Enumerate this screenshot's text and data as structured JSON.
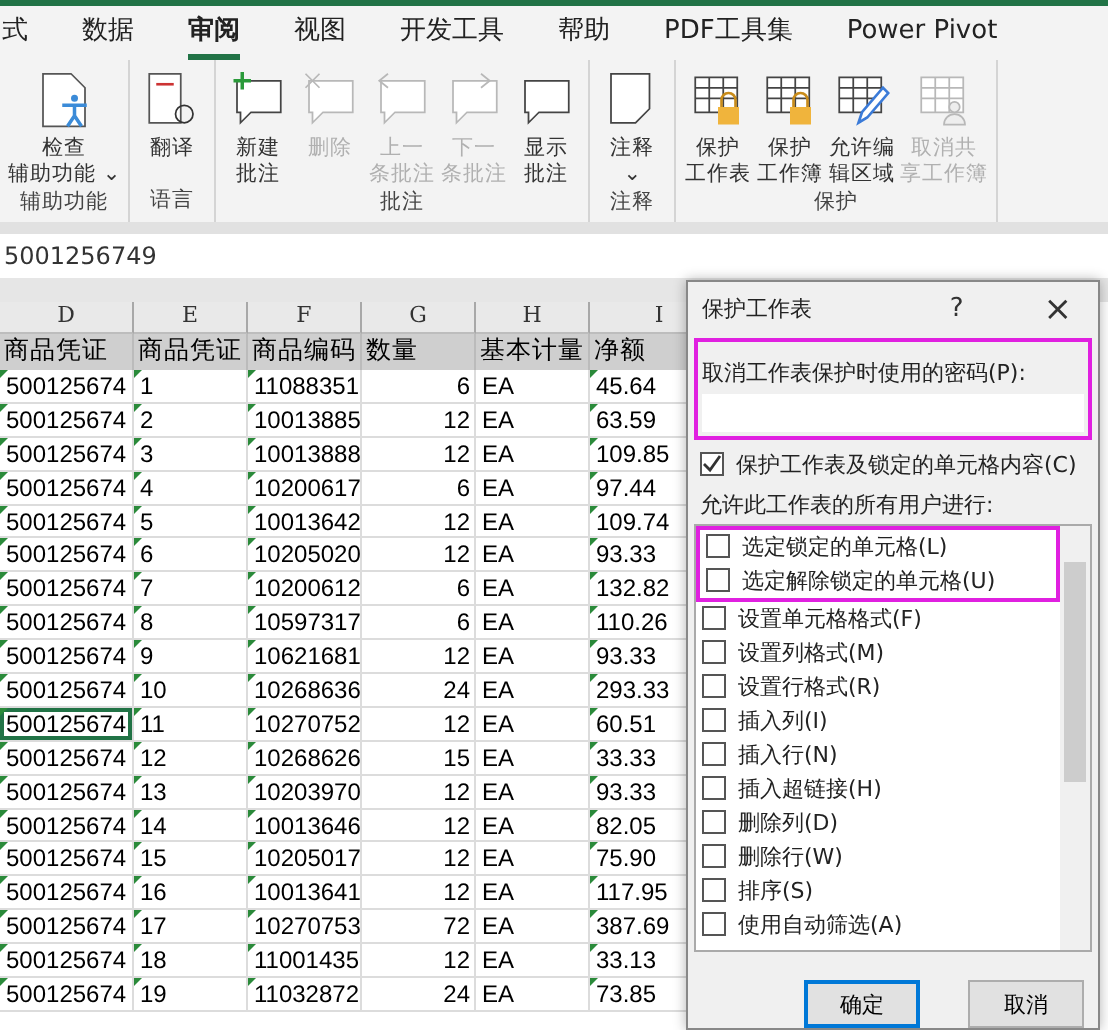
{
  "ribbon_tabs": [
    {
      "label": "式",
      "selected": false
    },
    {
      "label": "数据",
      "selected": false
    },
    {
      "label": "审阅",
      "selected": true
    },
    {
      "label": "视图",
      "selected": false
    },
    {
      "label": "开发工具",
      "selected": false
    },
    {
      "label": "帮助",
      "selected": false
    },
    {
      "label": "PDF工具集",
      "selected": false
    },
    {
      "label": "Power Pivot",
      "selected": false
    }
  ],
  "ribbon_groups": [
    {
      "label": "辅助功能",
      "buttons": [
        {
          "kind": "accessibility",
          "lines": [
            "检查",
            "辅助功能 ⌄"
          ],
          "disabled": false
        }
      ]
    },
    {
      "label": "语言",
      "buttons": [
        {
          "kind": "translate",
          "lines": [
            "翻译"
          ],
          "disabled": false
        }
      ]
    },
    {
      "label": "批注",
      "buttons": [
        {
          "kind": "new-comment",
          "lines": [
            "新建",
            "批注"
          ],
          "disabled": false
        },
        {
          "kind": "delete-comment",
          "lines": [
            "删除"
          ],
          "disabled": true
        },
        {
          "kind": "prev-comment",
          "lines": [
            "上一",
            "条批注"
          ],
          "disabled": true
        },
        {
          "kind": "next-comment",
          "lines": [
            "下一",
            "条批注"
          ],
          "disabled": true
        },
        {
          "kind": "show-comment",
          "lines": [
            "显示",
            "批注"
          ],
          "disabled": false
        }
      ]
    },
    {
      "label": "注释",
      "buttons": [
        {
          "kind": "note",
          "lines": [
            "注释",
            "⌄"
          ],
          "disabled": false
        }
      ]
    },
    {
      "label": "保护",
      "buttons": [
        {
          "kind": "protect-sheet",
          "lines": [
            "保护",
            "工作表"
          ],
          "disabled": false
        },
        {
          "kind": "protect-book",
          "lines": [
            "保护",
            "工作簿"
          ],
          "disabled": false
        },
        {
          "kind": "allow-edit",
          "lines": [
            "允许编",
            "辑区域"
          ],
          "disabled": false
        },
        {
          "kind": "unshare",
          "lines": [
            "取消共",
            "享工作簿"
          ],
          "disabled": true
        }
      ]
    }
  ],
  "formula_bar": {
    "value": "5001256749"
  },
  "sheet": {
    "columns": [
      "D",
      "E",
      "F",
      "G",
      "H",
      "I"
    ],
    "header_row": [
      "商品凭证",
      "商品凭证",
      "商品编码",
      "数量",
      "基本计量",
      "净额"
    ],
    "rows": [
      {
        "cells": [
          "500125674",
          "1",
          "11088351",
          "6",
          "EA",
          "45.64"
        ],
        "selected": false
      },
      {
        "cells": [
          "500125674",
          "2",
          "10013885",
          "12",
          "EA",
          "63.59"
        ],
        "selected": false
      },
      {
        "cells": [
          "500125674",
          "3",
          "10013888",
          "12",
          "EA",
          "109.85"
        ],
        "selected": false
      },
      {
        "cells": [
          "500125674",
          "4",
          "10200617",
          "6",
          "EA",
          "97.44"
        ],
        "selected": false
      },
      {
        "cells": [
          "500125674",
          "5",
          "10013642",
          "12",
          "EA",
          "109.74"
        ],
        "selected": false
      },
      {
        "cells": [
          "500125674",
          "6",
          "10205020",
          "12",
          "EA",
          "93.33"
        ],
        "selected": false
      },
      {
        "cells": [
          "500125674",
          "7",
          "10200612",
          "6",
          "EA",
          "132.82"
        ],
        "selected": false
      },
      {
        "cells": [
          "500125674",
          "8",
          "10597317",
          "6",
          "EA",
          "110.26"
        ],
        "selected": false
      },
      {
        "cells": [
          "500125674",
          "9",
          "10621681",
          "12",
          "EA",
          "93.33"
        ],
        "selected": false
      },
      {
        "cells": [
          "500125674",
          "10",
          "10268636",
          "24",
          "EA",
          "293.33"
        ],
        "selected": false
      },
      {
        "cells": [
          "500125674",
          "11",
          "10270752",
          "12",
          "EA",
          "60.51"
        ],
        "selected": true
      },
      {
        "cells": [
          "500125674",
          "12",
          "10268626",
          "15",
          "EA",
          "33.33"
        ],
        "selected": false
      },
      {
        "cells": [
          "500125674",
          "13",
          "10203970",
          "12",
          "EA",
          "93.33"
        ],
        "selected": false
      },
      {
        "cells": [
          "500125674",
          "14",
          "10013646",
          "12",
          "EA",
          "82.05"
        ],
        "selected": false
      },
      {
        "cells": [
          "500125674",
          "15",
          "10205017",
          "12",
          "EA",
          "75.90"
        ],
        "selected": false
      },
      {
        "cells": [
          "500125674",
          "16",
          "10013641",
          "12",
          "EA",
          "117.95"
        ],
        "selected": false
      },
      {
        "cells": [
          "500125674",
          "17",
          "10270753",
          "72",
          "EA",
          "387.69"
        ],
        "selected": false
      },
      {
        "cells": [
          "500125674",
          "18",
          "11001435",
          "12",
          "EA",
          "33.13"
        ],
        "selected": false
      },
      {
        "cells": [
          "500125674",
          "19",
          "11032872",
          "24",
          "EA",
          "73.85"
        ],
        "selected": false
      }
    ]
  },
  "dialog": {
    "title": "保护工作表",
    "help": "?",
    "close": "×",
    "password": {
      "label": "取消工作表保护时使用的密码(P):",
      "highlighted": true
    },
    "protect_checkbox": {
      "label": "保护工作表及锁定的单元格内容(C)",
      "checked": true
    },
    "allow_label": "允许此工作表的所有用户进行:",
    "permissions": [
      {
        "label": "选定锁定的单元格(L)",
        "checked": false,
        "highlighted": true
      },
      {
        "label": "选定解除锁定的单元格(U)",
        "checked": false,
        "highlighted": true
      },
      {
        "label": "设置单元格格式(F)",
        "checked": false,
        "highlighted": false
      },
      {
        "label": "设置列格式(M)",
        "checked": false,
        "highlighted": false
      },
      {
        "label": "设置行格式(R)",
        "checked": false,
        "highlighted": false
      },
      {
        "label": "插入列(I)",
        "checked": false,
        "highlighted": false
      },
      {
        "label": "插入行(N)",
        "checked": false,
        "highlighted": false
      },
      {
        "label": "插入超链接(H)",
        "checked": false,
        "highlighted": false
      },
      {
        "label": "删除列(D)",
        "checked": false,
        "highlighted": false
      },
      {
        "label": "删除行(W)",
        "checked": false,
        "highlighted": false
      },
      {
        "label": "排序(S)",
        "checked": false,
        "highlighted": false
      },
      {
        "label": "使用自动筛选(A)",
        "checked": false,
        "highlighted": false
      }
    ],
    "buttons": [
      {
        "label": "确定",
        "selected": true
      },
      {
        "label": "取消",
        "selected": false
      }
    ]
  }
}
